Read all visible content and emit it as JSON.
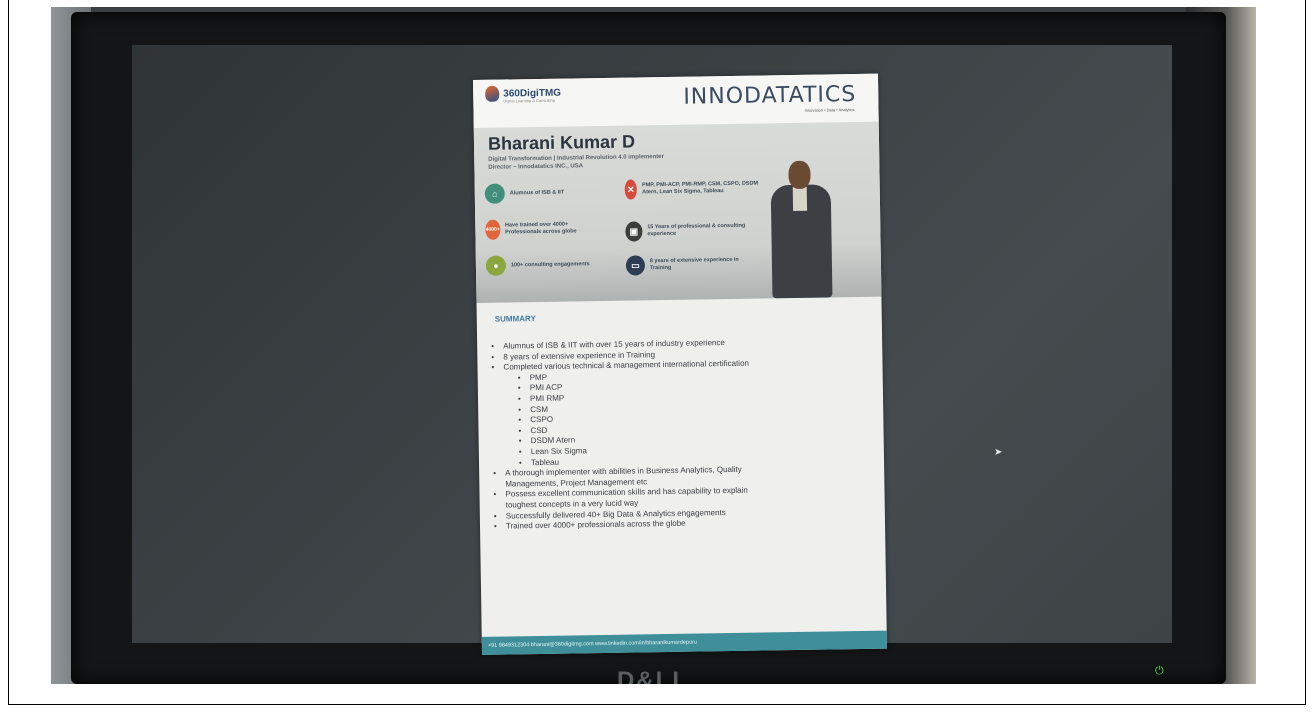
{
  "document": {
    "logo_left": "360DigiTMG",
    "logo_left_sub": "Digital Learning & Consulting",
    "logo_right": "INNODATATICS",
    "logo_right_sub": "Innovation • Data • Analytics",
    "name": "Bharani Kumar D",
    "role_line1": "Digital Transformation | Industrial Revolution 4.0 implementer",
    "role_line2": "Director – Innodatatics INC., USA",
    "features": [
      {
        "text": "Alumnus of ISB & IIT",
        "icon": "institution-icon",
        "color": "#3f8f7a"
      },
      {
        "text": "Have trained over 4000+ Professionals across globe",
        "icon": "badge-4000-icon",
        "color": "#e0653a"
      },
      {
        "text": "100+ consulting engagements",
        "icon": "person-icon",
        "color": "#8aa63c"
      },
      {
        "text": "PMP, PMI-ACP, PMI-RMP, CSM, CSPO, DSDM Atern, Lean Six Sigma, Tableau",
        "icon": "tools-icon",
        "color": "#d94a3a"
      },
      {
        "text": "15 Years of professional & consulting experience",
        "icon": "briefcase-icon",
        "color": "#3b3f3a"
      },
      {
        "text": "8 years of extensive experience in Training",
        "icon": "presentation-icon",
        "color": "#2d3d55"
      }
    ],
    "summary_title": "SUMMARY",
    "bullets": [
      {
        "text": "Alumnus of ISB & IIT with over 15 years of industry experience",
        "level": 1
      },
      {
        "text": "8 years of extensive experience in Training",
        "level": 1
      },
      {
        "text": "Completed various technical & management international certification",
        "level": 1
      },
      {
        "text": "PMP",
        "level": 2
      },
      {
        "text": "PMI ACP",
        "level": 2
      },
      {
        "text": "PMI RMP",
        "level": 2
      },
      {
        "text": "CSM",
        "level": 2
      },
      {
        "text": "CSPO",
        "level": 2
      },
      {
        "text": "CSD",
        "level": 2
      },
      {
        "text": "DSDM Atern",
        "level": 2
      },
      {
        "text": "Lean Six Sigma",
        "level": 2
      },
      {
        "text": "Tableau",
        "level": 2
      },
      {
        "text": "A thorough implementer with abilities in Business Analytics, Quality",
        "level": 1
      },
      {
        "text": "Managements, Project Management etc",
        "level": 0
      },
      {
        "text": "Possess excellent communication skills and has capability to explain",
        "level": 1
      },
      {
        "text": "toughest concepts in a very lucid way",
        "level": 0
      },
      {
        "text": "Successfully delivered 40+ Big Data & Analytics engagements",
        "level": 1
      },
      {
        "text": "Trained over 4000+ professionals across the globe",
        "level": 1
      }
    ],
    "footer": "+91 9849312304   bharani@360digitmg.com   www.linkedin.com/in/bharanikumardepuru"
  },
  "monitor": {
    "brand": "D&LL",
    "power_icon": "power-icon",
    "power_color": "#49e04a"
  }
}
